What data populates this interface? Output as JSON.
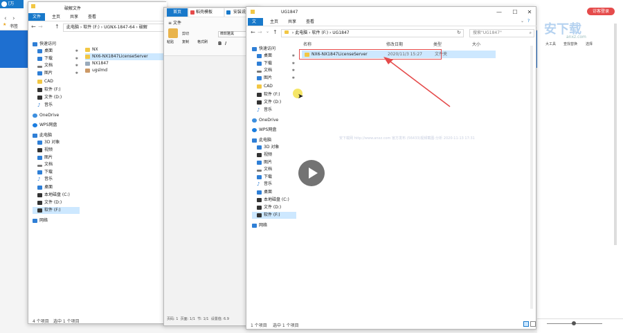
{
  "browser": {
    "tab1_label": "[万",
    "tab2_label": "破解文件",
    "tab_home_label": "首页",
    "tab_template_label": "稻壳模板",
    "tab_install_label": "安装说",
    "login_button": "访客登录",
    "bookmark_label": "书签",
    "right_tools": [
      "大工具",
      "查找替换",
      "选择"
    ],
    "watermark_main": "安下载",
    "watermark_sub": "anxz.com",
    "watermark_line": "安下载网 http://www.anxz.com 官方发布 (56433)视频截图-分析 2020-11-13 17:31"
  },
  "win1": {
    "ribbon_tabs": [
      "文件",
      "主页",
      "共享",
      "查看"
    ],
    "address": [
      "此电脑",
      "软件 (F:)",
      "UGNX-1847-64",
      "破解"
    ],
    "nav": [
      {
        "label": "快速访问",
        "icon": "star-icon",
        "pinned": false
      },
      {
        "label": "桌面",
        "icon": "desktop-icon",
        "pinned": true
      },
      {
        "label": "下载",
        "icon": "download-icon",
        "pinned": true
      },
      {
        "label": "文档",
        "icon": "document-icon",
        "pinned": true
      },
      {
        "label": "图片",
        "icon": "picture-icon",
        "pinned": true
      },
      {
        "label": "CAD",
        "icon": "folder-icon",
        "pinned": false
      },
      {
        "label": "软件 (F:)",
        "icon": "drive-icon",
        "pinned": false
      },
      {
        "label": "文件 (D:)",
        "icon": "drive-icon",
        "pinned": false
      },
      {
        "label": "音乐",
        "icon": "music-icon",
        "pinned": false
      },
      {
        "label": "OneDrive",
        "icon": "onedrive-icon",
        "pinned": false
      },
      {
        "label": "WPS网盘",
        "icon": "wps-icon",
        "pinned": false
      },
      {
        "label": "此电脑",
        "icon": "computer-icon",
        "pinned": false
      },
      {
        "label": "3D 对象",
        "icon": "3d-icon",
        "pinned": false
      },
      {
        "label": "视频",
        "icon": "video-icon",
        "pinned": false
      },
      {
        "label": "图片",
        "icon": "picture-icon",
        "pinned": false
      },
      {
        "label": "文档",
        "icon": "document-icon",
        "pinned": false
      },
      {
        "label": "下载",
        "icon": "download-icon",
        "pinned": false
      },
      {
        "label": "音乐",
        "icon": "music-icon",
        "pinned": false
      },
      {
        "label": "桌面",
        "icon": "desktop-icon",
        "pinned": false
      },
      {
        "label": "本地磁盘 (C:)",
        "icon": "drive-icon",
        "pinned": false
      },
      {
        "label": "文件 (D:)",
        "icon": "drive-icon",
        "pinned": false
      },
      {
        "label": "软件 (F:)",
        "icon": "drive-icon",
        "pinned": false
      },
      {
        "label": "网络",
        "icon": "network-icon",
        "pinned": false
      }
    ],
    "files": [
      "NX",
      "NX6-NX1847LicenseServer",
      "NX1847",
      "ugslmd"
    ],
    "status_count": "4 个项目",
    "status_selected": "选中 1 个项目"
  },
  "wps": {
    "menu_label": "文件",
    "toolbar": [
      "粘贴",
      "剪切",
      "复制",
      "格式刷"
    ],
    "font_name": "微软雅黑",
    "status": [
      "页码: 1",
      "页面: 1/1",
      "节: 1/1",
      "设置值: 6.9"
    ]
  },
  "win3": {
    "title": "UG1847",
    "ribbon_tabs": [
      "文件",
      "主页",
      "共享",
      "查看"
    ],
    "address": [
      "此电脑",
      "软件 (F:)",
      "UG1847"
    ],
    "search_placeholder": "搜索\"UG1847\"",
    "columns": [
      "名称",
      "修改日期",
      "类型",
      "大小"
    ],
    "nav": [
      {
        "label": "快速访问",
        "pinned": false
      },
      {
        "label": "桌面",
        "pinned": true
      },
      {
        "label": "下载",
        "pinned": true
      },
      {
        "label": "文档",
        "pinned": true
      },
      {
        "label": "图片",
        "pinned": true
      },
      {
        "label": "CAD",
        "pinned": false
      },
      {
        "label": "软件 (F:)",
        "pinned": false
      },
      {
        "label": "文件 (D:)",
        "pinned": false
      },
      {
        "label": "音乐",
        "pinned": false
      },
      {
        "label": "OneDrive",
        "pinned": false
      },
      {
        "label": "WPS网盘",
        "pinned": false
      },
      {
        "label": "此电脑",
        "pinned": false
      },
      {
        "label": "3D 对象",
        "pinned": false
      },
      {
        "label": "视频",
        "pinned": false
      },
      {
        "label": "图片",
        "pinned": false
      },
      {
        "label": "文档",
        "pinned": false
      },
      {
        "label": "下载",
        "pinned": false
      },
      {
        "label": "音乐",
        "pinned": false
      },
      {
        "label": "桌面",
        "pinned": false
      },
      {
        "label": "本地磁盘 (C:)",
        "pinned": false
      },
      {
        "label": "文件 (D:)",
        "pinned": false
      },
      {
        "label": "软件 (F:)",
        "pinned": false
      },
      {
        "label": "网络",
        "pinned": false
      }
    ],
    "file": {
      "name": "NX6-NX1847LicenseServer",
      "date": "2020/11/3 15:27",
      "type": "文件夹"
    },
    "status_count": "1 个项目",
    "status_selected": "选中 1 个项目"
  },
  "colors": {
    "accent": "#1979ca",
    "highlight": "#e54b4b",
    "folder": "#f2c744"
  }
}
